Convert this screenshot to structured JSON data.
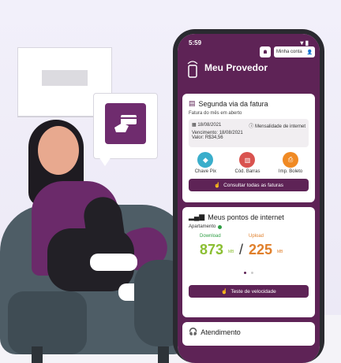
{
  "status_bar": {
    "time": "5:59"
  },
  "header": {
    "title": "Meu Provedor",
    "account_label": "Minha conta"
  },
  "invoice_card": {
    "title": "Segunda via da fatura",
    "subtitle": "Fatura do mês em aberto",
    "date": "18/08/2021",
    "plan": "Mensalidade de internet",
    "due": "Vencimento: 18/08/2021",
    "amount": "Valor: R$34,56",
    "actions": [
      {
        "label": "Chave Pix",
        "icon": "pix-icon",
        "color": "#3aaecb"
      },
      {
        "label": "Cód. Barras",
        "icon": "barcode-icon",
        "color": "#d9534f"
      },
      {
        "label": "Imp. Boleto",
        "icon": "printer-icon",
        "color": "#f08a24"
      }
    ],
    "button_label": "Consultar todas as faturas"
  },
  "internet_card": {
    "title": "Meus pontos de internet",
    "location": "Apartamento",
    "download_label": "Download",
    "upload_label": "Upload",
    "download_value": "873",
    "upload_value": "225",
    "unit": "MB",
    "button_label": "Teste de velocidade"
  },
  "support_card": {
    "title": "Atendimento"
  },
  "colors": {
    "brand": "#5e2356",
    "download": "#8bbf33",
    "upload": "#e07f2a"
  }
}
